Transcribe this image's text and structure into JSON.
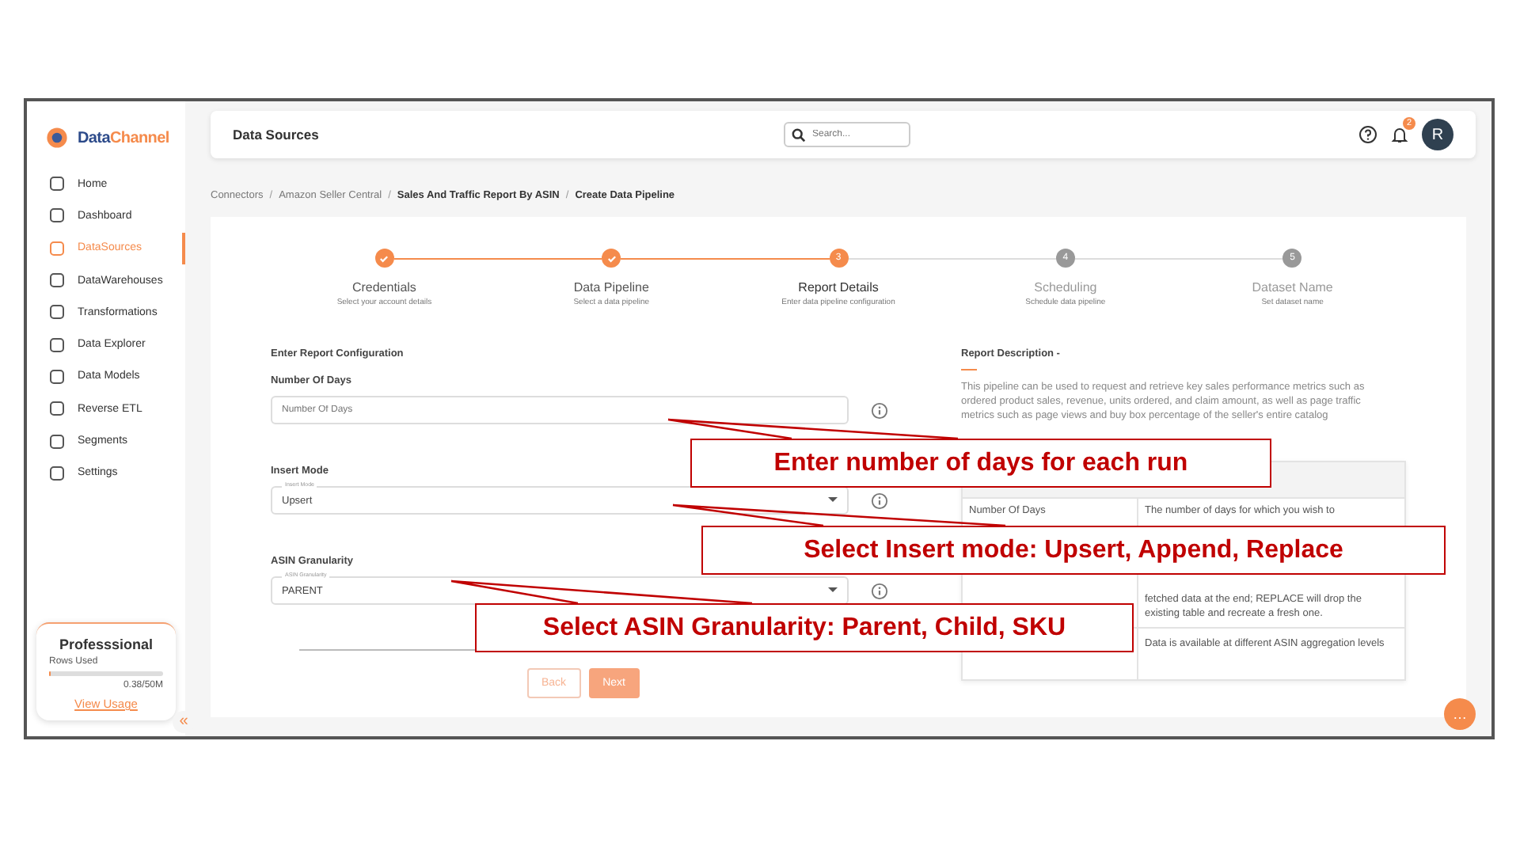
{
  "sidebar": {
    "logo": {
      "brand_first": "Data",
      "brand_second": "Channel"
    },
    "items": [
      {
        "label": "Home",
        "selected": false
      },
      {
        "label": "Dashboard",
        "selected": false
      },
      {
        "label": "DataSources",
        "selected": true
      },
      {
        "label": "DataWarehouses",
        "selected": false
      },
      {
        "label": "Transformations",
        "selected": false
      },
      {
        "label": "Data Explorer",
        "selected": false
      },
      {
        "label": "Data Models",
        "selected": false
      },
      {
        "label": "Reverse ETL",
        "selected": false
      },
      {
        "label": "Segments",
        "selected": false
      },
      {
        "label": "Settings",
        "selected": false
      }
    ],
    "plan": {
      "name": "Professsional",
      "usage_label": "Rows Used",
      "level": 0.01,
      "reading": "0.38/50M",
      "link": "View Usage"
    },
    "collapse": "«"
  },
  "header": {
    "title": "Data Sources",
    "search": {
      "placeholder": "Search..."
    },
    "notification_count": "2",
    "avatar": "R"
  },
  "breadcrumb": [
    {
      "label": "Connectors",
      "current": false
    },
    {
      "separator": "/"
    },
    {
      "label": "Amazon Seller Central",
      "current": false
    },
    {
      "separator": "/"
    },
    {
      "label": "Sales And Traffic Report By ASIN",
      "current": true
    },
    {
      "separator": "/"
    },
    {
      "label": "Create Data Pipeline",
      "current": true
    }
  ],
  "steps": [
    {
      "label": "Credentials",
      "sub": "Select your account details",
      "completed": true,
      "selected": false
    },
    {
      "label": "Data Pipeline",
      "sub": "Select a data pipeline",
      "completed": true,
      "selected": false
    },
    {
      "label": "Report Details",
      "sub": "Enter data pipeline configuration",
      "number": "3",
      "completed": false,
      "selected": true
    },
    {
      "label": "Scheduling",
      "sub": "Schedule data pipeline",
      "number": "4",
      "completed": false,
      "selected": false
    },
    {
      "label": "Dataset Name",
      "sub": "Set dataset name",
      "number": "5",
      "completed": false,
      "selected": false
    }
  ],
  "form": {
    "title": "Enter Report Configuration",
    "fields": [
      {
        "kind": "input",
        "label": "Number Of Days",
        "placeholder": "Number Of Days"
      },
      {
        "kind": "select",
        "label": "Insert Mode",
        "floating_label": "Insert Mode",
        "value": "Upsert"
      },
      {
        "kind": "select",
        "label": "ASIN Granularity",
        "floating_label": "ASIN Granularity",
        "value": "PARENT"
      }
    ],
    "buttons": [
      {
        "label": "Back",
        "kind": "secondary"
      },
      {
        "label": "Next",
        "kind": "primary"
      }
    ]
  },
  "description": {
    "title": "Report Description -",
    "text": "This pipeline can be used to request and retrieve key sales performance metrics such as ordered product sales, revenue, units ordered, and claim amount, as well as page traffic metrics such as page views and buy box percentage of the seller's entire catalog",
    "rows": [
      {
        "name": "Number Of Days",
        "text": "The number of days for which you wish to"
      },
      {
        "name": "",
        "text": "fetched data at the end; REPLACE will drop the existing table and recreate a fresh one."
      },
      {
        "name": "",
        "text": "Data is available at different ASIN aggregation levels"
      }
    ]
  },
  "callouts": [
    "Enter number of days for each run",
    "Select Insert mode: Upsert, Append, Replace",
    "Select ASIN Granularity: Parent, Child, SKU"
  ],
  "chat_button": "…"
}
